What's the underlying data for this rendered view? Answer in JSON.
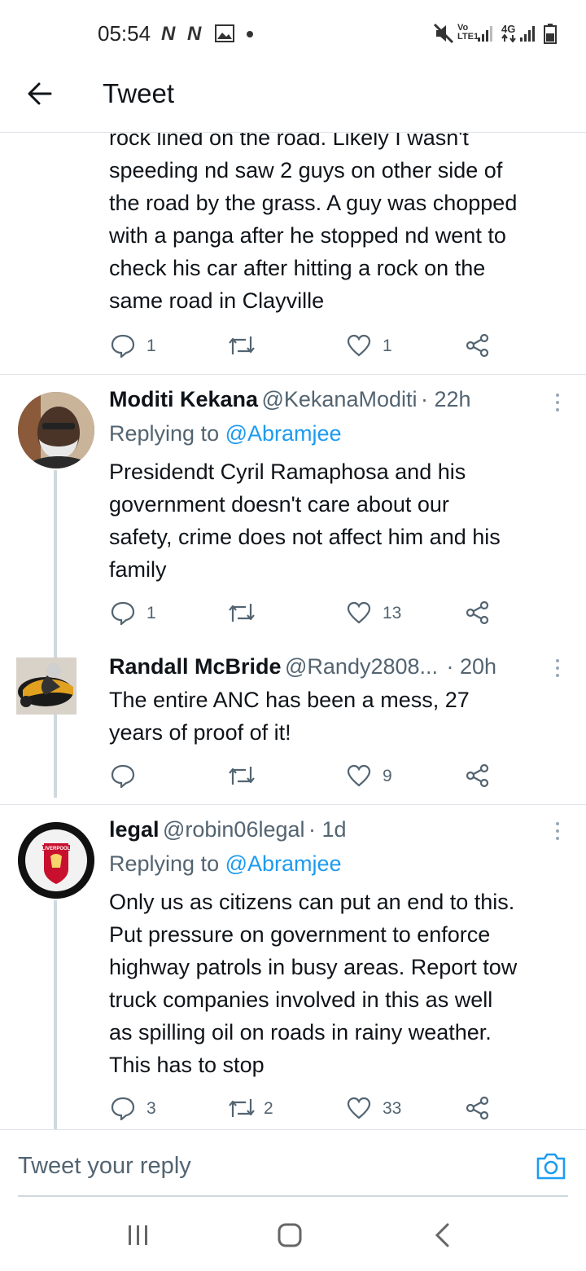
{
  "status_bar": {
    "time": "05:54",
    "notif_1": "N",
    "notif_2": "N",
    "network_1_top": "Vo",
    "network_1_bottom": "LTE1",
    "network_2": "4G"
  },
  "header": {
    "title": "Tweet"
  },
  "tweets": [
    {
      "text": "rock lined on the road. Likely I wasn't speeding nd saw 2 guys on other side of the road by the grass. A guy was chopped with a panga after he stopped nd went to check his car after hitting a rock on the same road in Clayville",
      "lines": [
        "rock lined on the road. Likely I wasn't",
        "speeding nd saw 2 guys on other side of",
        "the road by the grass. A guy was chopped",
        "with a panga after he stopped nd went to",
        "check his car after hitting a rock on the",
        "same road in Clayville"
      ],
      "replies": "1",
      "retweets": "",
      "likes": "1"
    },
    {
      "name": "Moditi Kekana",
      "handle": "@KekanaModiti",
      "time": "· 22h",
      "replying_prefix": "Replying to",
      "replying_to": "@Abramjee",
      "lines": [
        "Presidendt Cyril Ramaphosa and his",
        "government doesn't care about our",
        "safety, crime does not affect him and his",
        "family"
      ],
      "replies": "1",
      "retweets": "",
      "likes": "13"
    },
    {
      "name": "Randall McBride",
      "handle": "@Randy2808...",
      "time": "· 20h",
      "lines": [
        "The entire ANC has been a mess, 27",
        "years of proof of it!"
      ],
      "replies": "",
      "retweets": "",
      "likes": "9"
    },
    {
      "name": "legal",
      "handle": "@robin06legal",
      "time": "· 1d",
      "replying_prefix": "Replying to",
      "replying_to": "@Abramjee",
      "lines": [
        "Only us as citizens can put an end to this.",
        "Put pressure on government to enforce",
        "highway patrols in busy areas. Report tow",
        "truck companies involved in this as well",
        "as spilling oil on roads in rainy weather.",
        "This has to stop"
      ],
      "replies": "3",
      "retweets": "2",
      "likes": "33",
      "avatar_text": "LIVERPOOL"
    }
  ],
  "reply_bar": {
    "placeholder": "Tweet your reply"
  },
  "icons": {
    "back": "arrow-left-icon",
    "reply": "reply-icon",
    "retweet": "retweet-icon",
    "like": "heart-icon",
    "share": "share-icon",
    "more": "more-vertical-icon",
    "camera": "camera-icon",
    "nav_recents": "recents-icon",
    "nav_home": "home-icon",
    "nav_back": "nav-back-icon"
  },
  "colors": {
    "accent": "#1d9bf0",
    "text": "#0f1419",
    "secondary": "#536471"
  }
}
